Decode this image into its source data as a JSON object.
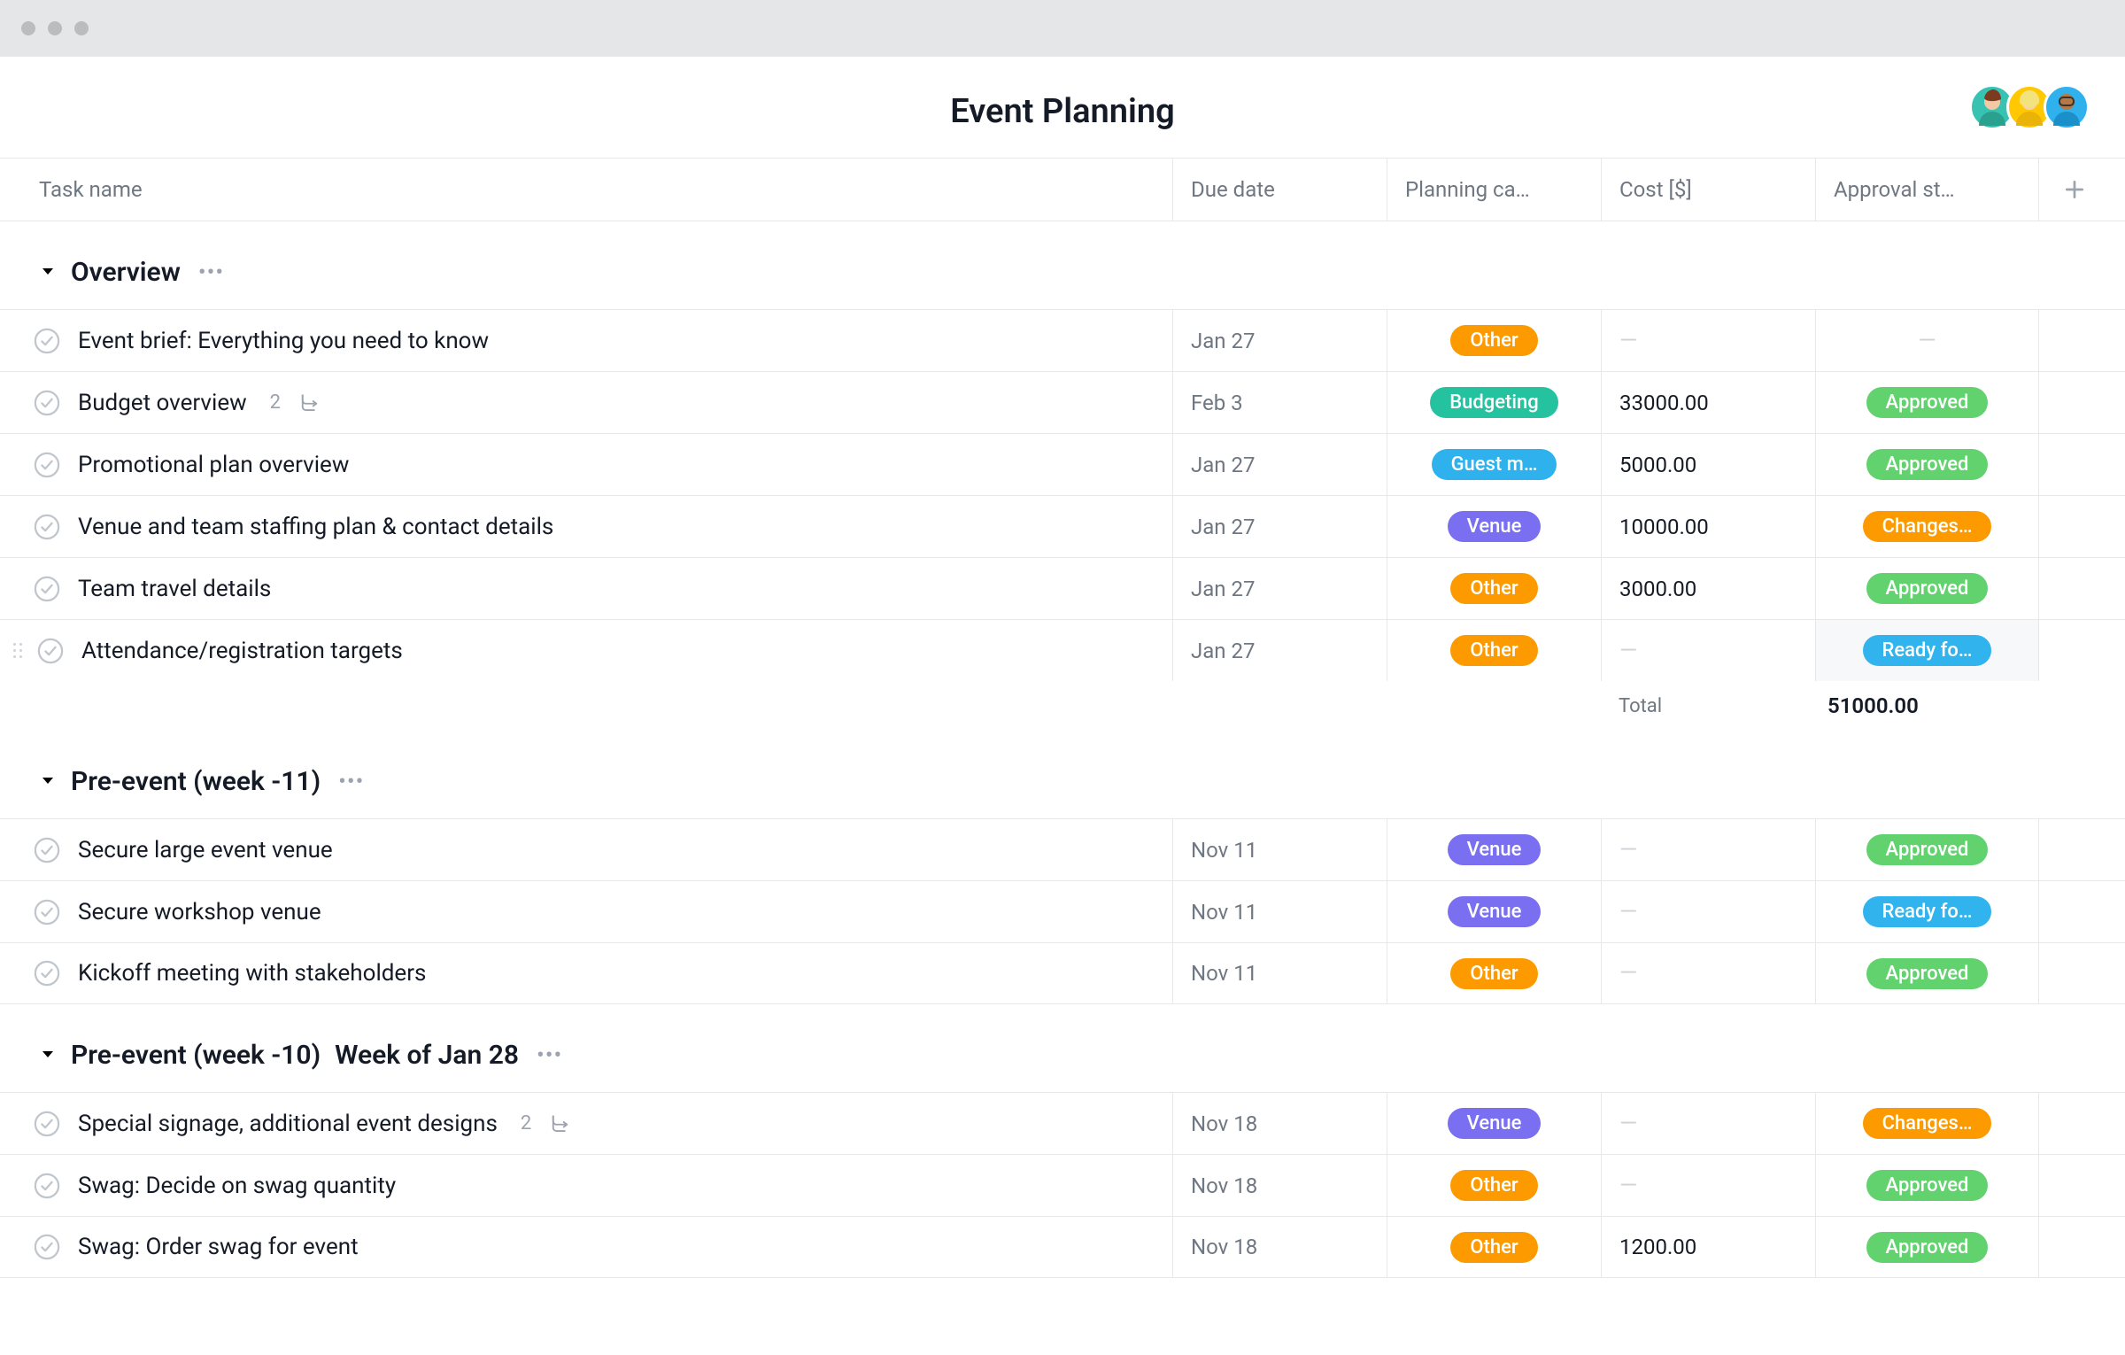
{
  "page": {
    "title": "Event Planning"
  },
  "avatars": [
    "a1",
    "a2",
    "a3"
  ],
  "columns": {
    "name": "Task name",
    "due": "Due date",
    "cat": "Planning ca…",
    "cost": "Cost [$]",
    "status": "Approval st…"
  },
  "tags": {
    "other": {
      "label": "Other",
      "cls": "pill-orange"
    },
    "budgeting": {
      "label": "Budgeting",
      "cls": "pill-teal"
    },
    "guestm": {
      "label": "Guest m…",
      "cls": "pill-blue"
    },
    "venue": {
      "label": "Venue",
      "cls": "pill-purple"
    }
  },
  "statuses": {
    "approved": {
      "label": "Approved",
      "cls": "pill-green"
    },
    "changes": {
      "label": "Changes…",
      "cls": "pill-orange"
    },
    "ready": {
      "label": "Ready fo…",
      "cls": "pill-blue2"
    }
  },
  "totals": {
    "label": "Total",
    "value": "51000.00"
  },
  "sections": [
    {
      "title": "Overview",
      "showTotal": true,
      "tasks": [
        {
          "name": "Event brief: Everything you need to know",
          "due": "Jan 27",
          "cat": "other",
          "cost": "",
          "status": ""
        },
        {
          "name": "Budget overview",
          "due": "Feb 3",
          "cat": "budgeting",
          "cost": "33000.00",
          "status": "approved",
          "sub": "2"
        },
        {
          "name": "Promotional plan overview",
          "due": "Jan 27",
          "cat": "guestm",
          "cost": "5000.00",
          "status": "approved"
        },
        {
          "name": "Venue and team staffing plan & contact details",
          "due": "Jan 27",
          "cat": "venue",
          "cost": "10000.00",
          "status": "changes"
        },
        {
          "name": "Team travel details",
          "due": "Jan 27",
          "cat": "other",
          "cost": "3000.00",
          "status": "approved"
        },
        {
          "name": "Attendance/registration targets",
          "due": "Jan 27",
          "cat": "other",
          "cost": "",
          "status": "ready",
          "hover": true
        }
      ]
    },
    {
      "title": "Pre-event (week -11)",
      "tasks": [
        {
          "name": "Secure large event venue",
          "due": "Nov 11",
          "cat": "venue",
          "cost": "",
          "status": "approved"
        },
        {
          "name": "Secure workshop venue",
          "due": "Nov 11",
          "cat": "venue",
          "cost": "",
          "status": "ready"
        },
        {
          "name": "Kickoff meeting with stakeholders",
          "due": "Nov 11",
          "cat": "other",
          "cost": "",
          "status": "approved"
        }
      ]
    },
    {
      "title": "Pre-event (week -10)",
      "subtitle": "Week of Jan 28",
      "tasks": [
        {
          "name": "Special signage, additional event designs",
          "due": "Nov 18",
          "cat": "venue",
          "cost": "",
          "status": "changes",
          "sub": "2"
        },
        {
          "name": "Swag: Decide on swag quantity",
          "due": "Nov 18",
          "cat": "other",
          "cost": "",
          "status": "approved"
        },
        {
          "name": "Swag: Order swag for event",
          "due": "Nov 18",
          "cat": "other",
          "cost": "1200.00",
          "status": "approved"
        }
      ]
    }
  ]
}
